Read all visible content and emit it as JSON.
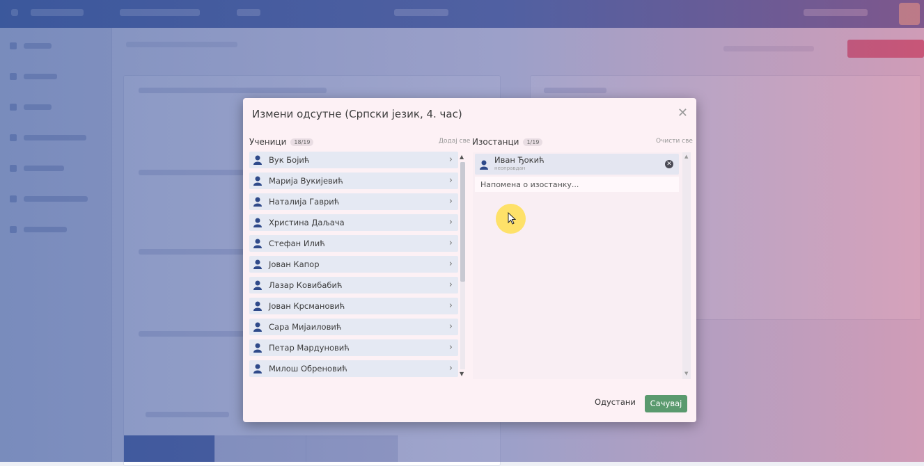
{
  "modal": {
    "title": "Измени одсутне (Српски језик, 4. час)",
    "close_icon": "close-icon",
    "students_label": "Ученици",
    "students_count": "18/19",
    "add_all_link": "Додај све",
    "absent_label": "Изостанци",
    "absent_count": "1/19",
    "clear_all_link": "Очисти све",
    "students": [
      "Вук Бојић",
      "Марија Вукијевић",
      "Наталија Гаврић",
      "Христина Даљача",
      "Стефан Илић",
      "Јован Капор",
      "Лазар Ковибабић",
      "Јован Крсмановић",
      "Сара Мијаиловић",
      "Петар Мардуновић",
      "Милош Обреновић"
    ],
    "absent": {
      "name": "Иван Ђокић",
      "subtitle": "неоправдан",
      "note_placeholder": "Напомена о изостанку..."
    },
    "cancel_label": "Одустани",
    "save_label": "Сачувај"
  },
  "colors": {
    "accent_green": "#5a9a6e",
    "topbar": "#3d5a99",
    "danger": "#e0566b",
    "row_bg": "#e5e9f3",
    "cursor_highlight": "#ffde50"
  },
  "icons": {
    "student": "user-icon",
    "chevron": "chevron-right-icon",
    "remove": "remove-circle-icon"
  }
}
